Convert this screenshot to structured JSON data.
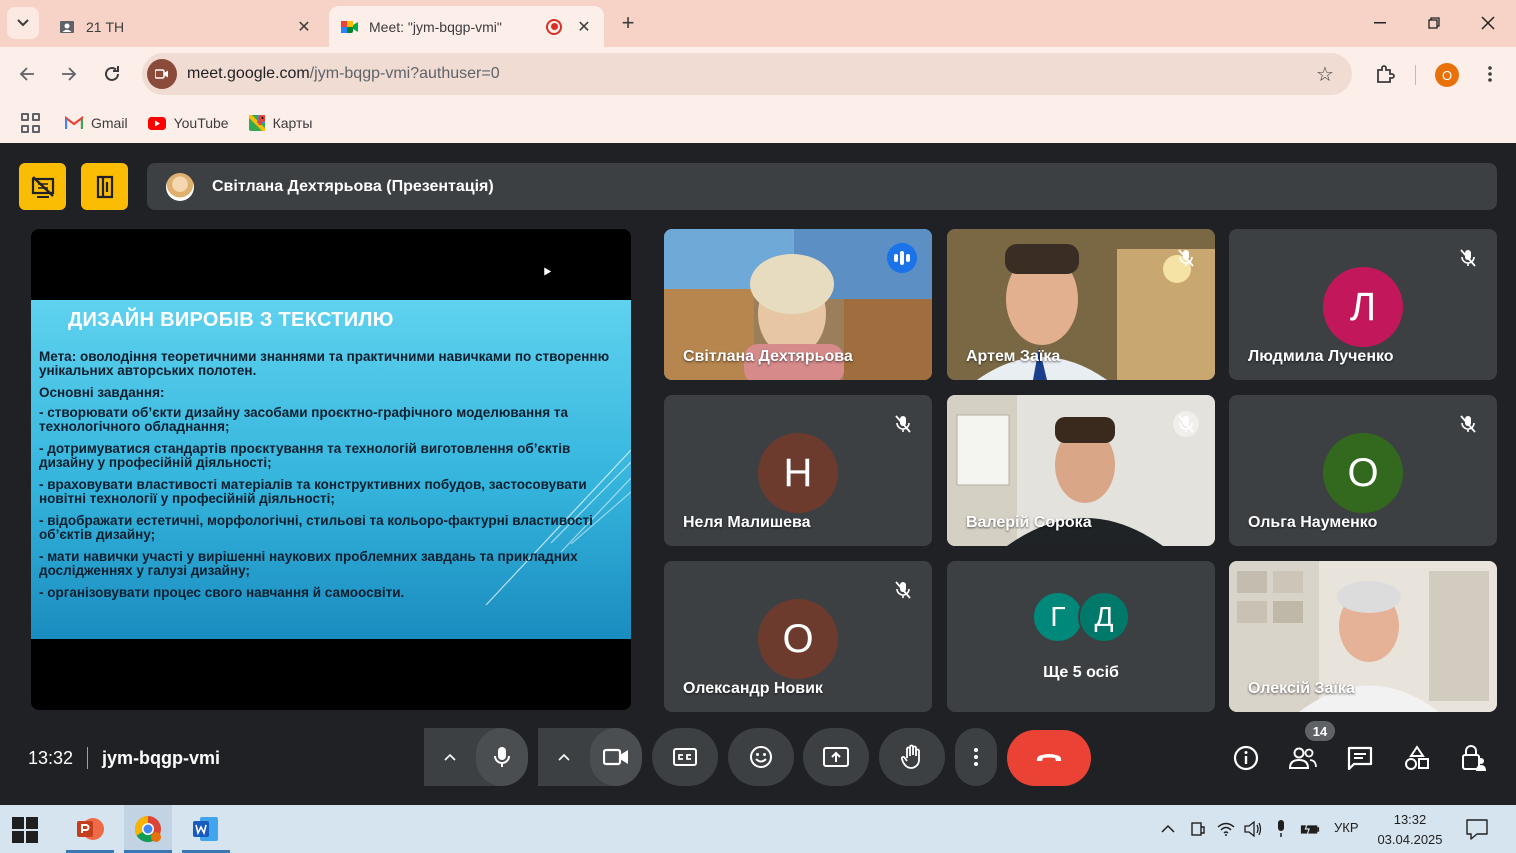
{
  "browser": {
    "tabs": [
      {
        "title": "21 ТН",
        "icon": "portrait-icon"
      },
      {
        "title": "Meet: \"jym-bqgp-vmi\"",
        "icon": "meet-icon",
        "recording": true,
        "active": true
      }
    ],
    "url": {
      "host": "meet.google.com",
      "path": "/jym-bqgp-vmi?authuser=0"
    },
    "profile_initial": "O",
    "bookmarks": [
      {
        "label": "Gmail",
        "icon": "gmail-icon"
      },
      {
        "label": "YouTube",
        "icon": "youtube-icon"
      },
      {
        "label": "Карты",
        "icon": "maps-icon"
      }
    ]
  },
  "meet": {
    "presenter_label": "Світлана Дехтярьова (Презентація)",
    "slide": {
      "title": "ДИЗАЙН ВИРОБІВ З ТЕКСТИЛЮ",
      "lines": [
        "Мета: оволодіння теоретичними знаннями та практичними навичками по створенню унікальних авторських полотен.",
        "Основні завдання:",
        "- створювати об’єкти дизайну засобами проєктно-графічного моделювання та технологічного обладнання;",
        "-  дотримуватися стандартів проєктування та технологій виготовлення об’єктів дизайну у професійній діяльності;",
        "-  враховувати властивості матеріалів та конструктивних побудов, застосовувати новітні технології у професійній діяльності;",
        "-  відображати естетичні, морфологічні, стильові та кольоро-фактурні властивості об’єктів дизайну;",
        "- мати навички участі у вирішенні наукових проблемних завдань та прикладних дослідженнях у галузі дизайну;",
        "-  організовувати процес свого навчання й самоосвіти."
      ]
    },
    "participants": [
      {
        "name": "Світлана Дехтярьова",
        "type": "video",
        "speaking": true
      },
      {
        "name": "Артем Заїка",
        "type": "video",
        "muted": true
      },
      {
        "name": "Людмила Лученко",
        "type": "avatar",
        "initial": "Л",
        "color": "#c2185b",
        "muted": true
      },
      {
        "name": "Неля Малишева",
        "type": "avatar",
        "initial": "Н",
        "color": "#6d3b2e",
        "muted": true
      },
      {
        "name": "Валерій Сорока",
        "type": "video",
        "muted": true
      },
      {
        "name": "Ольга Науменко",
        "type": "avatar",
        "initial": "О",
        "color": "#33691e",
        "muted": true
      },
      {
        "name": "Олександр Новик",
        "type": "avatar",
        "initial": "О",
        "color": "#6d3b2e",
        "muted": true
      },
      {
        "name": "Ще 5 осіб",
        "type": "more",
        "initials": [
          {
            "letter": "Г",
            "color": "#00897b"
          },
          {
            "letter": "Д",
            "color": "#00796b"
          }
        ]
      },
      {
        "name": "Олексій Заїка",
        "type": "video"
      }
    ],
    "time": "13:32",
    "meeting_code": "jym-bqgp-vmi",
    "participant_count": "14"
  },
  "taskbar": {
    "lang": "УКР",
    "time": "13:32",
    "date": "03.04.2025"
  },
  "colors": {
    "end_call": "#ea4335",
    "speaking_border": "#8ab4f8",
    "hand_yellow": "#fbbc04"
  }
}
